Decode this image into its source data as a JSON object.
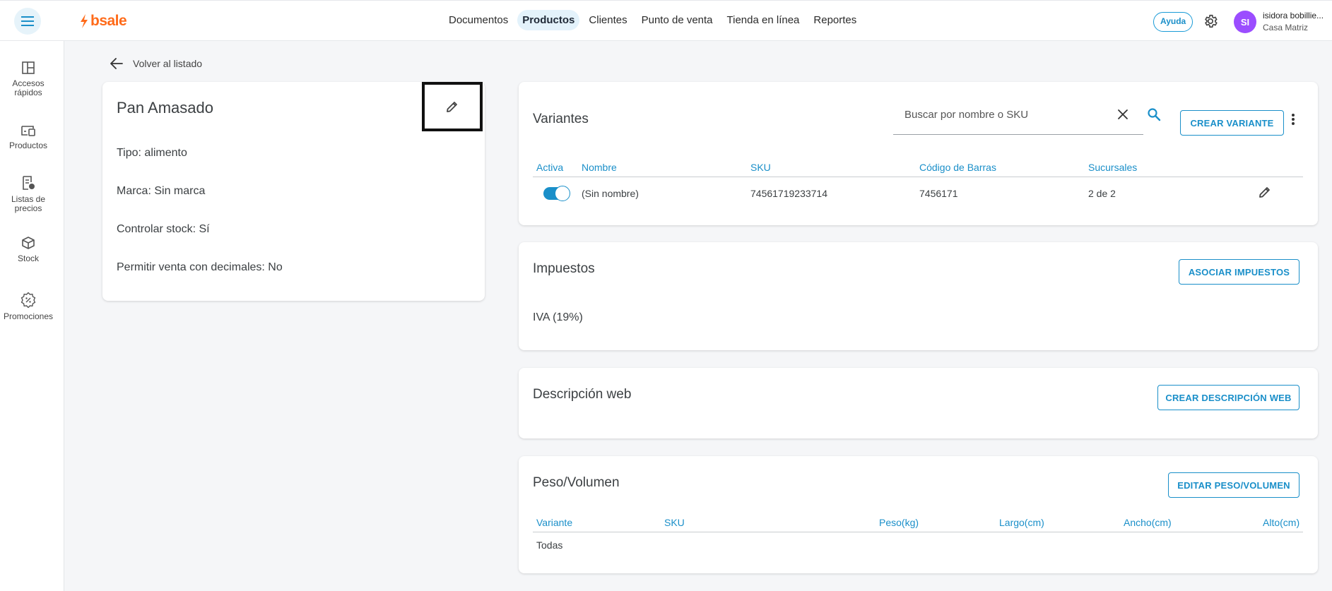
{
  "header": {
    "brand": "bsale",
    "nav": [
      {
        "label": "Documentos",
        "active": false
      },
      {
        "label": "Productos",
        "active": true
      },
      {
        "label": "Clientes",
        "active": false
      },
      {
        "label": "Punto de venta",
        "active": false
      },
      {
        "label": "Tienda en línea",
        "active": false
      },
      {
        "label": "Reportes",
        "active": false
      }
    ],
    "help_label": "Ayuda",
    "avatar_initials": "SI",
    "user_name": "isidora bobillie...",
    "user_branch": "Casa Matriz"
  },
  "sidebar": {
    "items": [
      {
        "label": "Accesos rápidos",
        "icon": "grid-layout-icon"
      },
      {
        "label": "Productos",
        "icon": "products-icon"
      },
      {
        "label": "Listas de precios",
        "icon": "price-list-icon"
      },
      {
        "label": "Stock",
        "icon": "box-icon"
      },
      {
        "label": "Promociones",
        "icon": "discount-icon"
      }
    ]
  },
  "back_link": "Volver al listado",
  "product": {
    "name": "Pan Amasado",
    "properties": [
      "Tipo: alimento",
      "Marca: Sin marca",
      "Controlar stock: Sí",
      "Permitir venta con decimales: No"
    ]
  },
  "variants": {
    "title": "Variantes",
    "search_placeholder": "Buscar por nombre o SKU",
    "create_button": "CREAR VARIANTE",
    "columns": [
      "Activa",
      "Nombre",
      "SKU",
      "Código de Barras",
      "Sucursales"
    ],
    "rows": [
      {
        "active": true,
        "name": "(Sin nombre)",
        "sku": "74561719233714",
        "barcode": "7456171",
        "branches": "2 de 2"
      }
    ]
  },
  "taxes": {
    "title": "Impuestos",
    "button": "ASOCIAR IMPUESTOS",
    "items": [
      "IVA (19%)"
    ]
  },
  "web_description": {
    "title": "Descripción web",
    "button": "CREAR DESCRIPCIÓN WEB"
  },
  "weight_volume": {
    "title": "Peso/Volumen",
    "button": "EDITAR PESO/VOLUMEN",
    "columns": [
      "Variante",
      "SKU",
      "Peso(kg)",
      "Largo(cm)",
      "Ancho(cm)",
      "Alto(cm)"
    ],
    "rows": [
      {
        "variant": "Todas",
        "sku": "",
        "weight": "",
        "length": "",
        "width": "",
        "height": ""
      }
    ]
  },
  "colors": {
    "accent": "#1a8fc9",
    "brand_orange": "#ff6b1a",
    "avatar": "#9b4dff"
  }
}
